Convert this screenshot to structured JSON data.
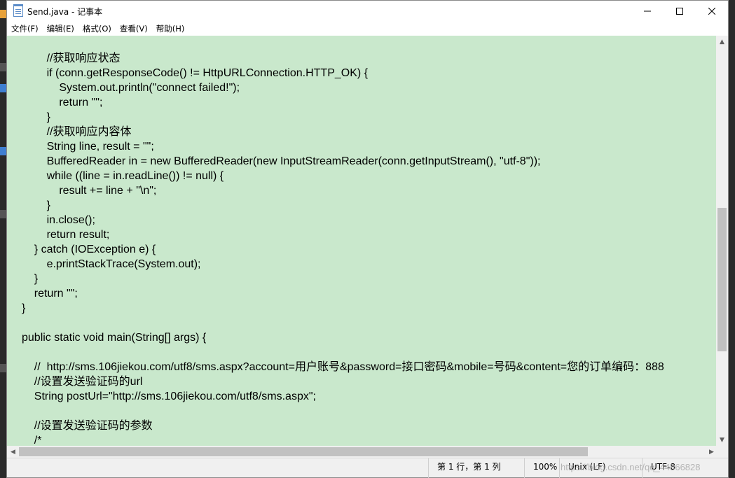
{
  "window": {
    "title": "Send.java - 记事本",
    "controls": {
      "minimize": "minimize-icon",
      "maximize": "maximize-icon",
      "close": "close-icon"
    }
  },
  "menu": {
    "items": [
      "文件(F)",
      "编辑(E)",
      "格式(O)",
      "查看(V)",
      "帮助(H)"
    ]
  },
  "editor": {
    "background": "#c9e8cc",
    "lines": [
      "        //获取响应状态",
      "        if (conn.getResponseCode() != HttpURLConnection.HTTP_OK) {",
      "            System.out.println(\"connect failed!\");",
      "            return \"\";",
      "        }",
      "        //获取响应内容体",
      "        String line, result = \"\";",
      "        BufferedReader in = new BufferedReader(new InputStreamReader(conn.getInputStream(), \"utf-8\"));",
      "        while ((line = in.readLine()) != null) {",
      "            result += line + \"\\n\";",
      "        }",
      "        in.close();",
      "        return result;",
      "    } catch (IOException e) {",
      "        e.printStackTrace(System.out);",
      "    }",
      "    return \"\";",
      "}",
      "",
      "public static void main(String[] args) {",
      "",
      "    //  http://sms.106jiekou.com/utf8/sms.aspx?account=用户账号&password=接口密码&mobile=号码&content=您的订单编码：888",
      "    //设置发送验证码的url",
      "    String postUrl=\"http://sms.106jiekou.com/utf8/sms.aspx\";",
      "",
      "    //设置发送验证码的参数",
      "    /*"
    ]
  },
  "status": {
    "position": "第 1 行，第 1 列",
    "zoom": "100%",
    "line_ending": "Unix (LF)",
    "encoding": "UTF-8",
    "watermark": "https://blog.csdn.net/qq_44866828"
  }
}
